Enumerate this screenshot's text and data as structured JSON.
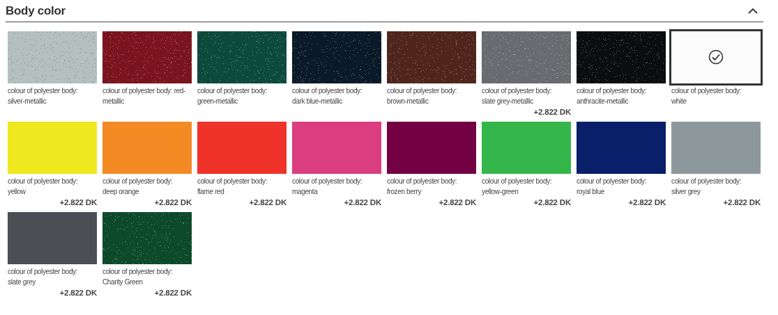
{
  "section": {
    "title": "Body color",
    "expanded": true
  },
  "colors": [
    {
      "label": "colour of polyester body: silver-metallic",
      "kind": "metallic",
      "color": "#b4c0c0",
      "selected": false
    },
    {
      "label": "colour of polyester body: red-metallic",
      "kind": "metallic",
      "color": "#7a1520",
      "selected": false
    },
    {
      "label": "colour of polyester body: green-metallic",
      "kind": "metallic",
      "color": "#0d4a3c",
      "selected": false
    },
    {
      "label": "colour of polyester body: dark blue-metallic",
      "kind": "metallic",
      "color": "#0a1a28",
      "selected": false
    },
    {
      "label": "colour of polyester body: brown-metallic",
      "kind": "metallic",
      "color": "#50261c",
      "selected": false
    },
    {
      "label": "colour of polyester body: slate grey-metallic",
      "kind": "metallic",
      "color": "#6a6b70",
      "selected": false,
      "price": "+2.822 DK"
    },
    {
      "label": "colour of polyester body: anthracite-metallic",
      "kind": "metallic",
      "color": "#0c0d0f",
      "selected": false
    },
    {
      "label": "colour of polyester body: white",
      "kind": "solid",
      "color": "#fbfbfb",
      "selected": true
    },
    {
      "label": "colour of polyester body: yellow",
      "kind": "solid",
      "color": "#f0e81e",
      "selected": false,
      "price": "+2.822 DK"
    },
    {
      "label": "colour of polyester body: deep orange",
      "kind": "solid",
      "color": "#f48a24",
      "selected": false,
      "price": "+2.822 DK"
    },
    {
      "label": "colour of polyester body: flame red",
      "kind": "solid",
      "color": "#ef332a",
      "selected": false,
      "price": "+2.822 DK"
    },
    {
      "label": "colour of polyester body: magenta",
      "kind": "solid",
      "color": "#db3e80",
      "selected": false,
      "price": "+2.822 DK"
    },
    {
      "label": "colour of polyester body: frozen berry",
      "kind": "solid",
      "color": "#730043",
      "selected": false,
      "price": "+2.822 DK"
    },
    {
      "label": "colour of polyester body: yellow-green",
      "kind": "solid",
      "color": "#35b64a",
      "selected": false,
      "price": "+2.822 DK"
    },
    {
      "label": "colour of polyester body: royal blue",
      "kind": "solid",
      "color": "#0a1f6a",
      "selected": false,
      "price": "+2.822 DK"
    },
    {
      "label": "colour of polyester body: silver grey",
      "kind": "solid",
      "color": "#8d989d",
      "selected": false,
      "price": "+2.822 DK"
    },
    {
      "label": "colour of polyester body: slate grey",
      "kind": "solid",
      "color": "#4b4e53",
      "selected": false,
      "price": "+2.822 DK"
    },
    {
      "label": "colour of polyester body: Charity Green",
      "kind": "metallic",
      "color": "#0c4a2a",
      "selected": false,
      "price": "+2.822 DK"
    }
  ]
}
